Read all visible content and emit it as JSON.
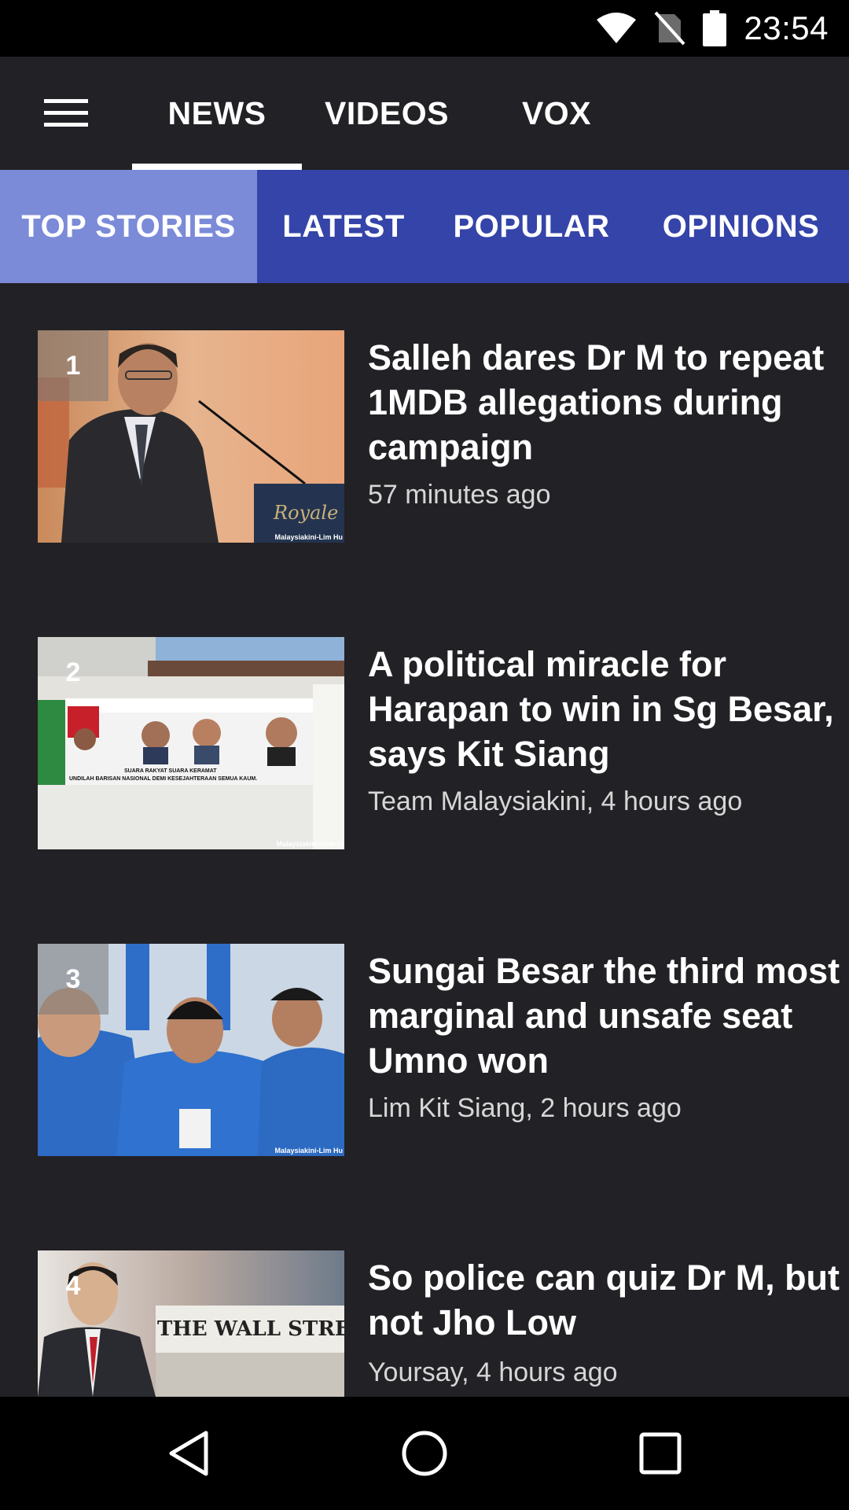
{
  "status_bar": {
    "time": "23:54",
    "icons": [
      "wifi-icon",
      "no-sim-icon",
      "battery-icon"
    ]
  },
  "top_nav": {
    "menu_icon": "hamburger-menu-icon",
    "tabs": [
      {
        "label": "NEWS",
        "active": true
      },
      {
        "label": "VIDEOS",
        "active": false
      },
      {
        "label": "VOX",
        "active": false
      }
    ]
  },
  "sub_nav": {
    "tabs": [
      {
        "label": "TOP STORIES",
        "active": true
      },
      {
        "label": "LATEST",
        "active": false
      },
      {
        "label": "POPULAR",
        "active": false
      },
      {
        "label": "OPINIONS",
        "active": false
      }
    ]
  },
  "stories": [
    {
      "rank": "1",
      "headline": "Salleh dares Dr M to repeat 1MDB allegations during campaign",
      "meta": "57 minutes ago",
      "credit": "Malaysiakini-Lim Hu",
      "podium_text": "Royale Chu"
    },
    {
      "rank": "2",
      "headline": "A political miracle for Harapan to win in Sg Besar, says Kit Siang",
      "meta": "Team Malaysiakini, 4 hours ago",
      "credit": "Malaysiakini-Kow G",
      "banner_line1": "SUARA RAKYAT SUARA KERAMAT",
      "banner_line2": "UNDILAH BARISAN NASIONAL DEMI KESEJAHTERAAN SEMUA KAUM."
    },
    {
      "rank": "3",
      "headline": "Sungai Besar the third most marginal and unsafe seat Umno won",
      "meta": "Lim Kit Siang, 2 hours ago",
      "credit": "Malaysiakini-Lim Hu"
    },
    {
      "rank": "4",
      "headline": "So police can quiz Dr M, but not Jho Low",
      "meta": "Yoursay, 4 hours ago",
      "newspaper_text": "THE WALL STREET JOURN"
    }
  ],
  "nav_bar": {
    "icons": [
      "back-icon",
      "home-icon",
      "recents-icon"
    ]
  }
}
